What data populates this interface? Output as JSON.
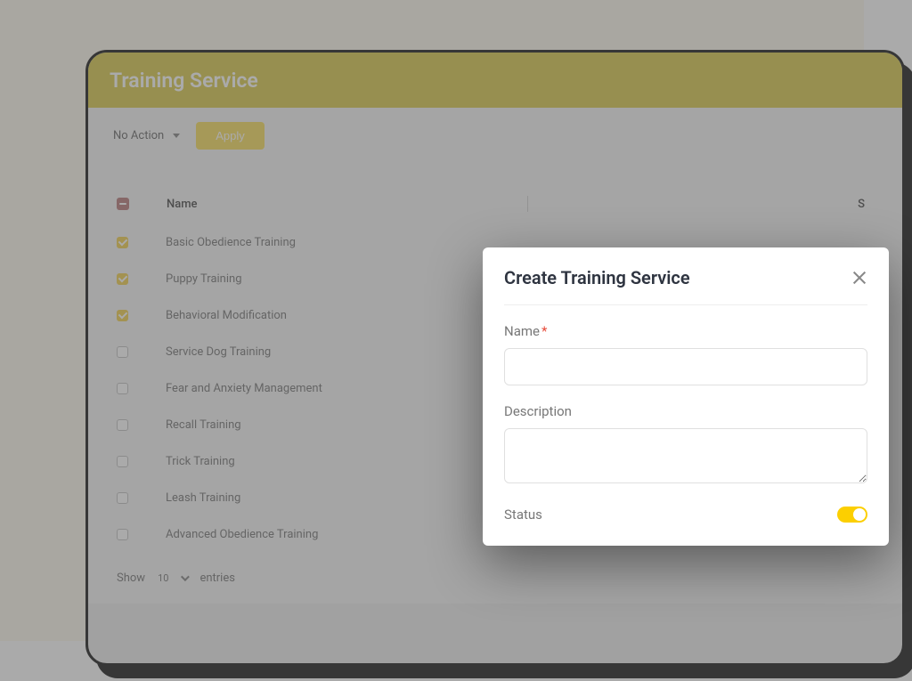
{
  "header": {
    "title": "Training Service"
  },
  "toolbar": {
    "action_select": "No Action",
    "apply_label": "Apply"
  },
  "table": {
    "columns": {
      "name": "Name",
      "status_partial": "S"
    },
    "rows": [
      {
        "name": "Basic Obedience Training",
        "checked": true
      },
      {
        "name": "Puppy Training",
        "checked": true
      },
      {
        "name": "Behavioral Modification",
        "checked": true
      },
      {
        "name": "Service Dog Training",
        "checked": false
      },
      {
        "name": "Fear and Anxiety Management",
        "checked": false
      },
      {
        "name": "Recall Training",
        "checked": false
      },
      {
        "name": "Trick Training",
        "checked": false
      },
      {
        "name": "Leash Training",
        "checked": false
      },
      {
        "name": "Advanced Obedience Training",
        "checked": false
      }
    ],
    "footer": {
      "show_label": "Show",
      "page_size": "10",
      "entries_label": "entries"
    }
  },
  "modal": {
    "title": "Create Training Service",
    "name_label": "Name",
    "name_value": "",
    "description_label": "Description",
    "description_value": "",
    "status_label": "Status",
    "status_on": true
  },
  "colors": {
    "accent": "#d4c438",
    "toggle": "#fccf00",
    "required": "#e74c3c",
    "cream": "#fdf9ec"
  }
}
